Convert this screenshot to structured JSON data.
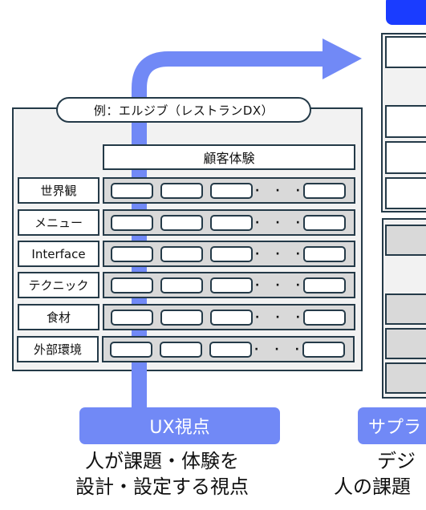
{
  "example_box": {
    "title": "例：エルジブ（レストランDX）",
    "header": "顧客体験",
    "rows": [
      {
        "label": "世界観"
      },
      {
        "label": "メニュー"
      },
      {
        "label": "Interface"
      },
      {
        "label": "テクニック"
      },
      {
        "label": "食材"
      },
      {
        "label": "外部環境"
      }
    ],
    "ellipsis": "・・・"
  },
  "ux_perspective": {
    "label": "UX視点",
    "caption_line1": "人が課題・体験を",
    "caption_line2": "設計・設定する視点"
  },
  "supply_perspective": {
    "label": "サプラ",
    "caption_line1": "デジ",
    "caption_line2": "人の課題"
  },
  "colors": {
    "arrow": "#7189f6",
    "label_bg": "#7189f6",
    "top_right_box": "#1a3cff",
    "border": "#243a48",
    "panel_bg": "#f2f2f2",
    "track_bg": "#d9d9d9"
  }
}
